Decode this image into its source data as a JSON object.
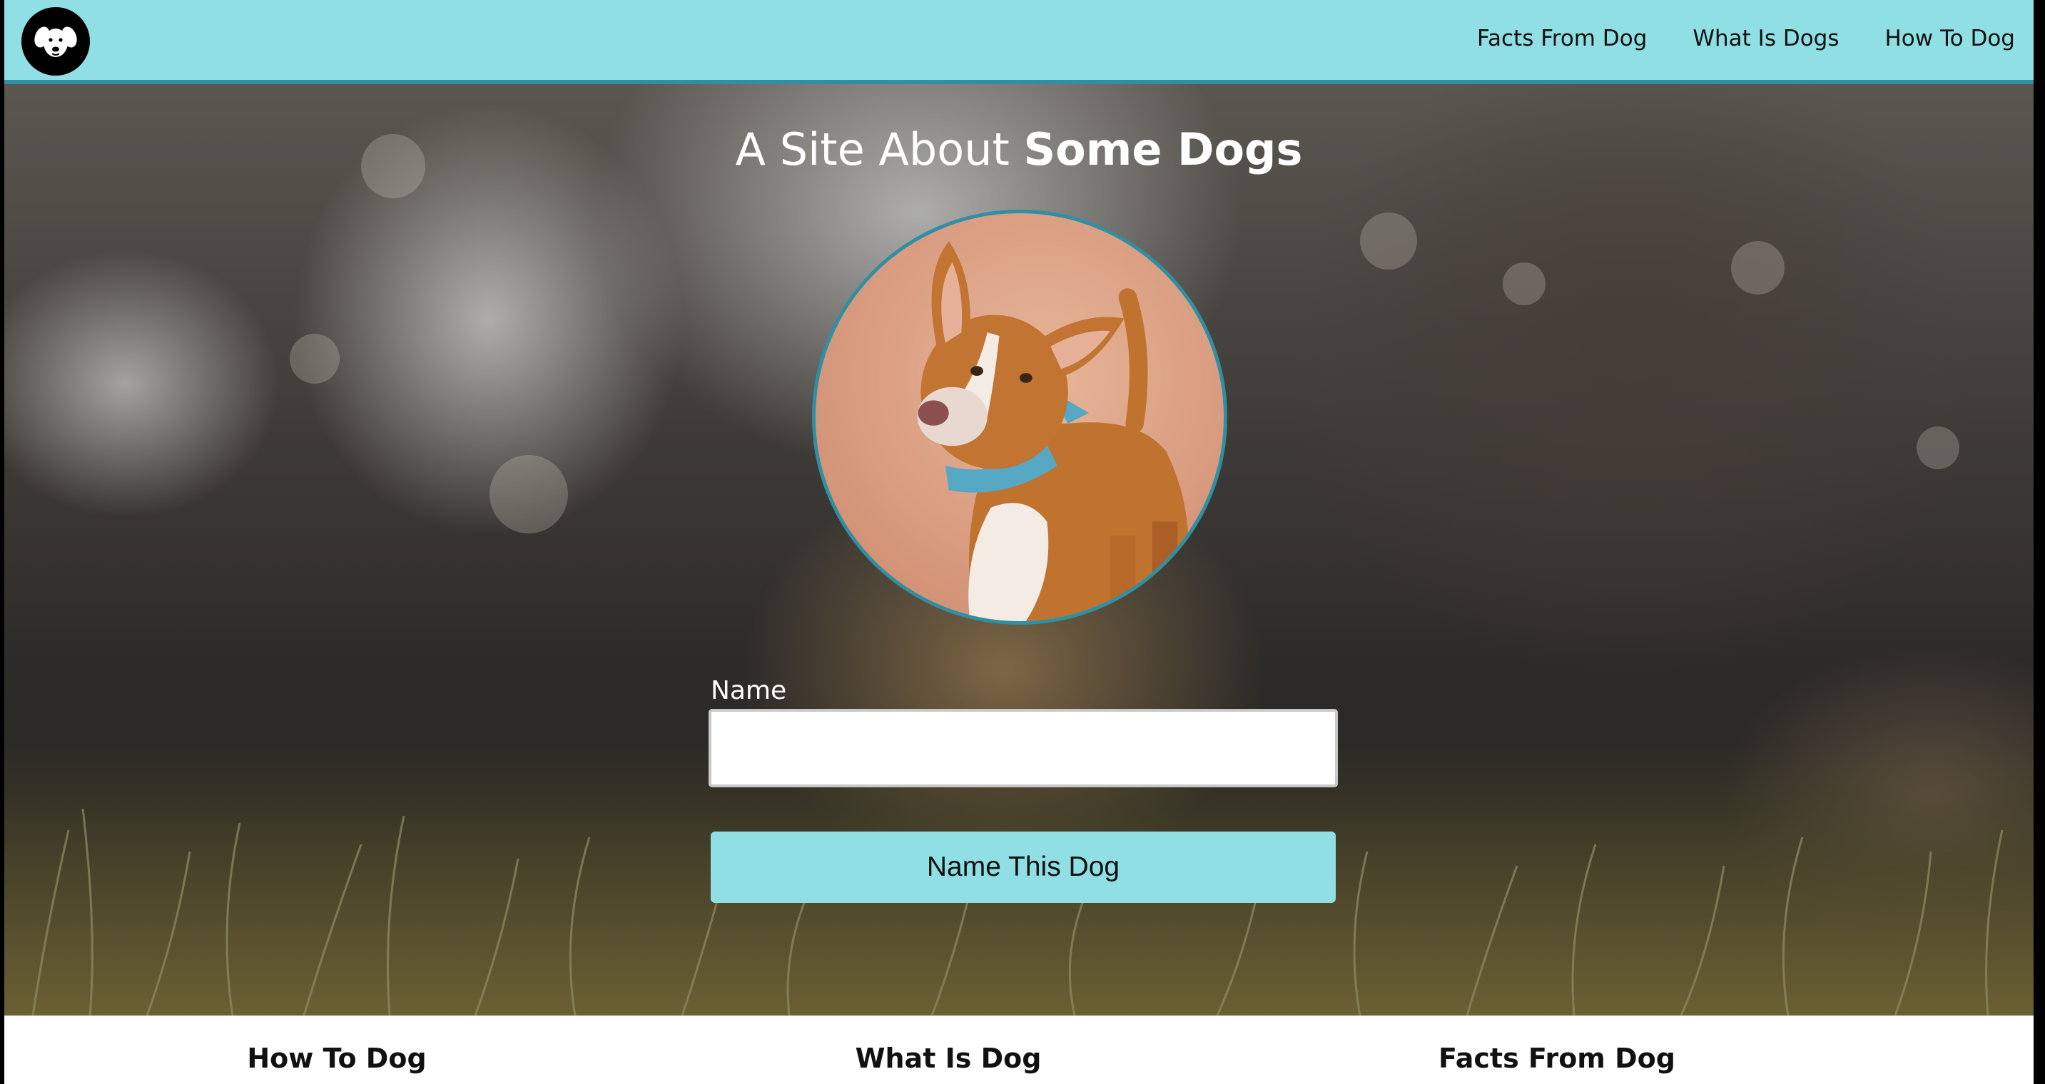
{
  "nav": {
    "logo_icon": "dog-face-icon",
    "links": [
      "Facts From Dog",
      "What Is Dogs",
      "How To Dog"
    ]
  },
  "hero": {
    "title_prefix": "A Site About",
    "title_emphasis": "Some Dogs",
    "photo_icon": "dog-photo",
    "form": {
      "name_label": "Name",
      "name_value": "",
      "submit_label": "Name This Dog"
    }
  },
  "features": {
    "titles": [
      "How To Dog",
      "What Is Dog",
      "Facts From Dog"
    ]
  },
  "colors": {
    "accent": "#8fdfe4",
    "border_accent": "#2f8fa3"
  }
}
